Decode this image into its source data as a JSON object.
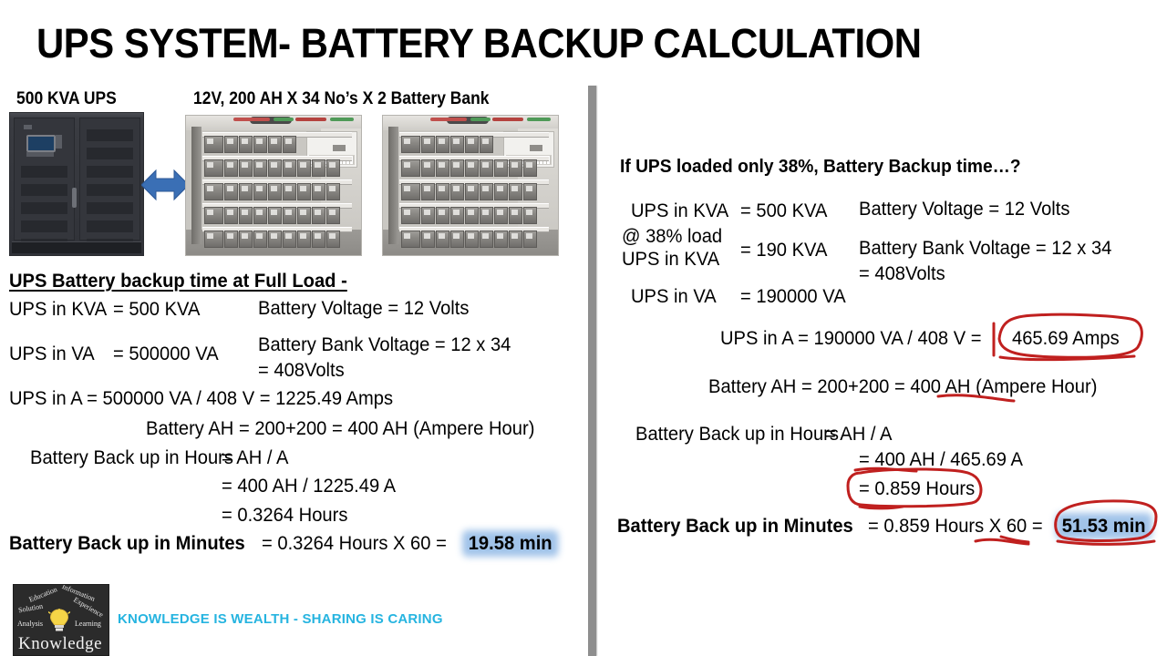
{
  "slide": {
    "title": "UPS SYSTEM- BATTERY BACKUP CALCULATION",
    "captions": {
      "ups": "500 KVA UPS",
      "battery_bank": "12V, 200 AH X 34 No’s X 2 Battery Bank"
    }
  },
  "left_panel": {
    "heading": "UPS Battery backup time at Full Load -",
    "col1": {
      "line1_label": "UPS in KVA",
      "line1_value": "= 500 KVA",
      "line2_label": "UPS in VA",
      "line2_value": "= 500000 VA"
    },
    "col2": {
      "battery_voltage": "Battery Voltage  = 12 Volts",
      "bank_voltage": "Battery Bank Voltage = 12 x 34",
      "bank_voltage_result": "= 408Volts"
    },
    "ups_in_a": "UPS in A = 500000 VA / 408 V  =  1225.49 Amps",
    "battery_ah": "Battery AH  = 200+200 = 400 AH (Ampere Hour)",
    "backup_hours_label": "Battery Back up in Hours",
    "backup_hours_formula": "= AH / A",
    "backup_hours_step1": "= 400 AH / 1225.49 A",
    "backup_hours_step2": "= 0.3264 Hours",
    "backup_minutes_label": "Battery Back up in Minutes",
    "backup_minutes_formula": "= 0.3264 Hours X 60 =",
    "backup_minutes_result": "19.58 min"
  },
  "right_panel": {
    "heading": "If UPS loaded only 38%, Battery Backup time…?",
    "col1": {
      "line1_label": "UPS in KVA",
      "line1_value": "= 500 KVA",
      "line2_label_a": "@ 38% load",
      "line2_label_b": "UPS in KVA",
      "line2_value": "= 190 KVA",
      "line3_label": "UPS in VA",
      "line3_value": "= 190000 VA"
    },
    "col2": {
      "battery_voltage": "Battery Voltage  = 12 Volts",
      "bank_voltage": "Battery Bank Voltage = 12 x 34",
      "bank_voltage_result": "= 408Volts"
    },
    "ups_in_a_prefix": "UPS in A = 190000 VA / 408 V  =",
    "ups_in_a_result": "465.69 Amps",
    "battery_ah": "Battery AH  = 200+200 = 400 AH (Ampere Hour)",
    "backup_hours_label": "Battery Back up in Hours",
    "backup_hours_formula": "= AH / A",
    "backup_hours_step1": "= 400 AH / 465.69 A",
    "backup_hours_step2": "= 0.859 Hours",
    "backup_minutes_label": "Battery Back up in Minutes",
    "backup_minutes_formula": "= 0.859 Hours X 60 =",
    "backup_minutes_result": "51.53 min"
  },
  "footer": {
    "tagline": "KNOWLEDGE IS WEALTH - SHARING IS CARING",
    "logo_words": [
      "Education",
      "Information",
      "Solution",
      "Experience",
      "Analysis",
      "Learning"
    ],
    "logo_title": "Knowledge"
  },
  "colors": {
    "highlight": "#9cc0e8",
    "annotation": "#c0201f",
    "divider": "#8e8e8e",
    "tagline": "#26b4e0",
    "arrow": "#3a6fb5"
  }
}
